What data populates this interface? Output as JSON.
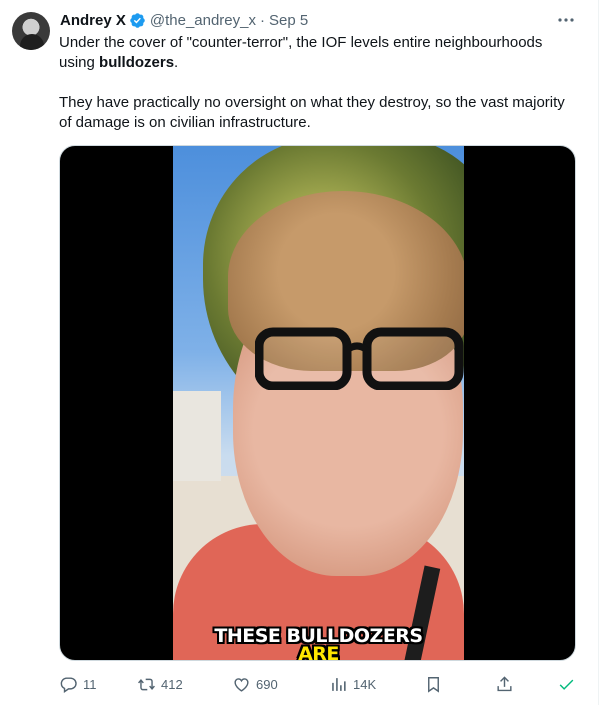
{
  "author": {
    "display_name": "Andrey X",
    "handle": "@the_andrey_x",
    "separator": "·",
    "date": "Sep 5"
  },
  "tweet": {
    "line1_pre": "Under the cover of \"counter-terror\", the IOF levels entire neighbourhoods using ",
    "line1_bold": "bulldozers",
    "line1_post": ".",
    "paragraph2": "They have practically no oversight on what they destroy, so the vast majority of damage is on civilian infrastructure."
  },
  "video": {
    "caption_line1": "THESE BULLDOZERS",
    "caption_line2": "ARE"
  },
  "actions": {
    "reply_count": "11",
    "retweet_count": "412",
    "like_count": "690",
    "views_count": "14K"
  },
  "colors": {
    "text": "#0f1419",
    "secondary": "#536471",
    "verified": "#1d9bf0",
    "check": "#00ba7c",
    "caption_yellow": "#ffe600"
  },
  "icons": [
    "more-icon",
    "verified-badge-icon",
    "reply-icon",
    "retweet-icon",
    "like-icon",
    "views-icon",
    "bookmark-icon",
    "share-icon",
    "checkmark-icon"
  ]
}
